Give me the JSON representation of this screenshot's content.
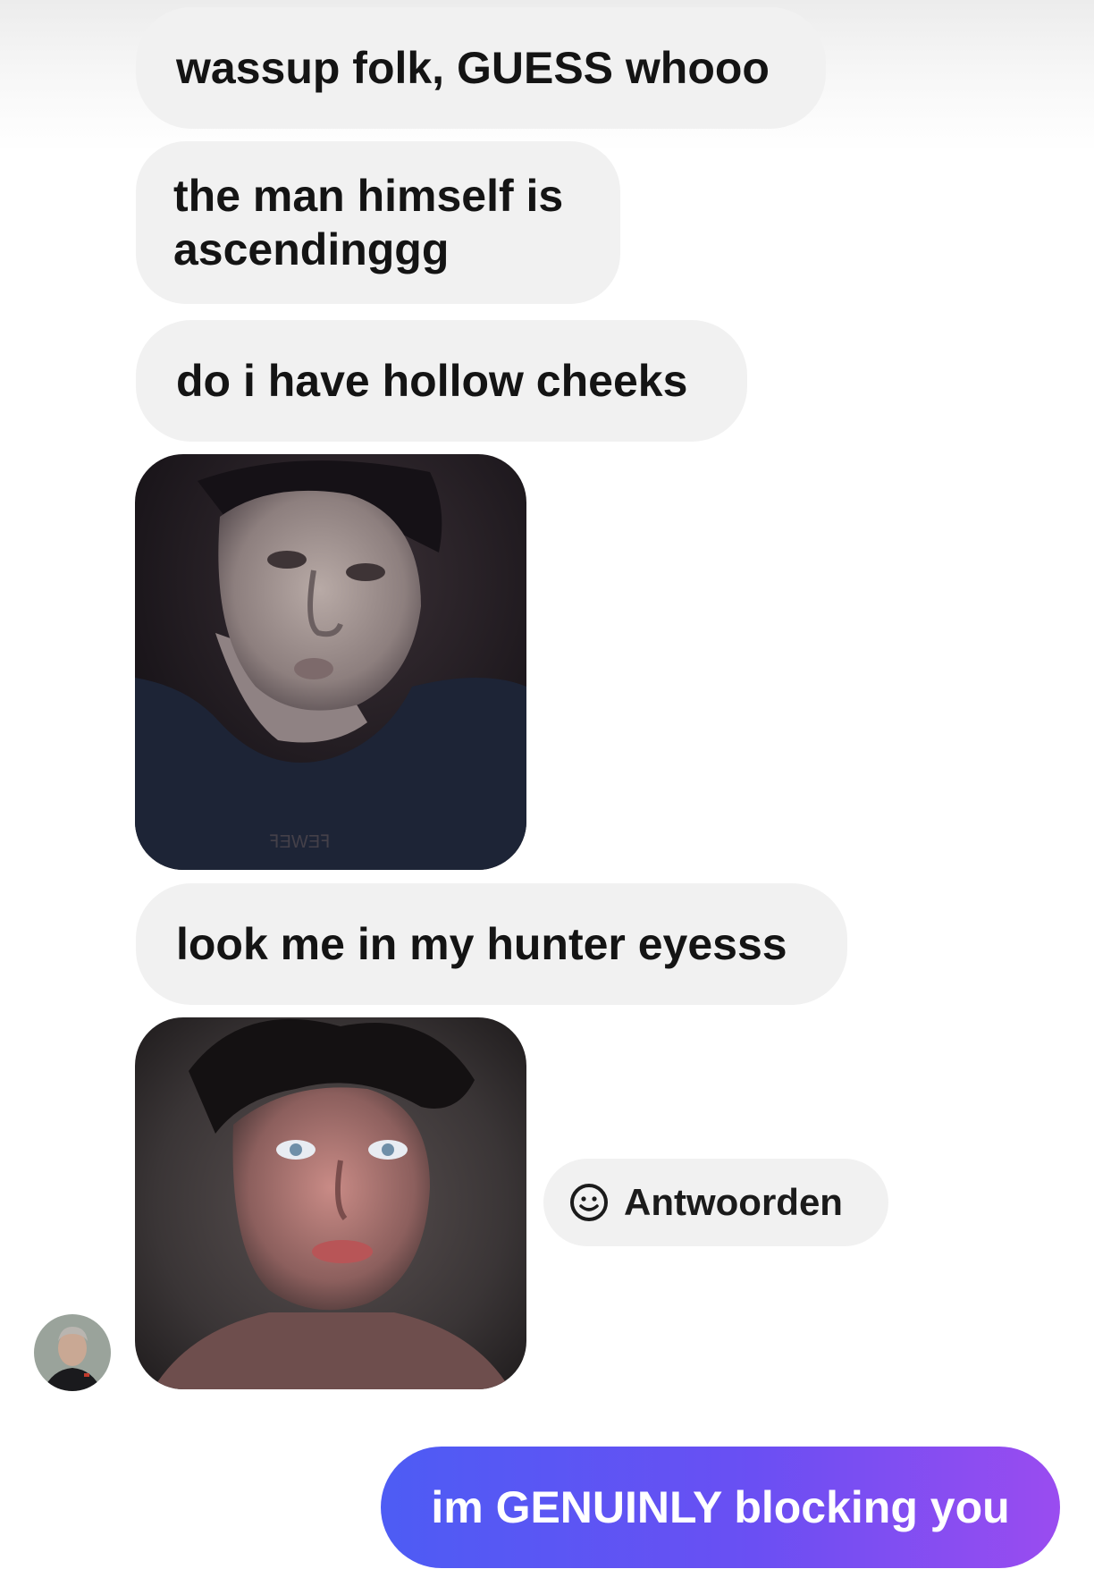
{
  "messages": {
    "m1": "wassup folk, GUESS whooo",
    "m2": "the man himself is ascendinggg",
    "m3": "do i have hollow cheeks",
    "m4": "look me in my hunter eyesss"
  },
  "reaction": {
    "label": "Antwoorden",
    "icon": "smiley-icon"
  },
  "sent_message": "im GENUINLY blocking you",
  "colors": {
    "received_bubble": "#f1f1f1",
    "sent_gradient_start": "#4d5cf4",
    "sent_gradient_end": "#9a4cf0"
  }
}
